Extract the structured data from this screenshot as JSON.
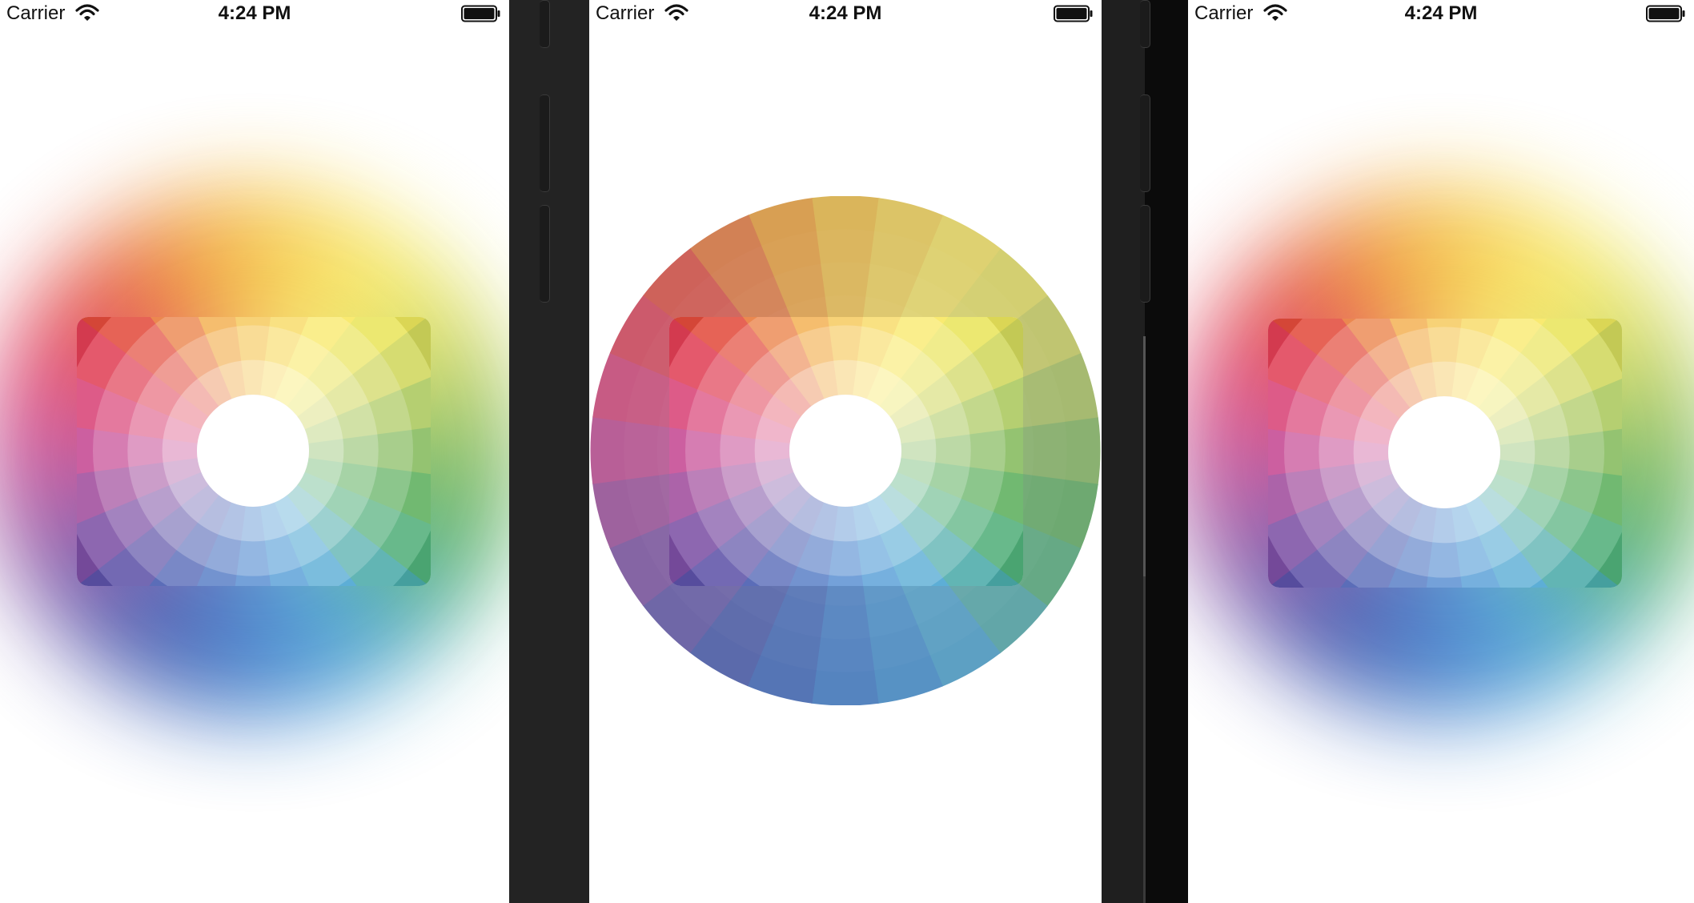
{
  "screens": [
    {
      "carrier": "Carrier",
      "time": "4:24 PM"
    },
    {
      "carrier": "Carrier",
      "time": "4:24 PM"
    },
    {
      "carrier": "Carrier",
      "time": "4:24 PM"
    }
  ],
  "wheel": {
    "segments": 24,
    "rings": 6,
    "hues": [
      "#f0a030",
      "#f3be3c",
      "#f6d44c",
      "#f8e65a",
      "#e9e45a",
      "#cfd65a",
      "#a9c75a",
      "#82b95a",
      "#5aae5a",
      "#4fae78",
      "#49a9a8",
      "#43a1cf",
      "#3b8ed0",
      "#3879c9",
      "#3764ba",
      "#4055ad",
      "#5c51a7",
      "#7b4ea3",
      "#9f4a9b",
      "#c44591",
      "#d84075",
      "#e03e54",
      "#e24a3a",
      "#e87534"
    ],
    "colors": {
      "icon": "#111111",
      "screen_bg": "#ffffff",
      "bezel": "#232323"
    }
  }
}
